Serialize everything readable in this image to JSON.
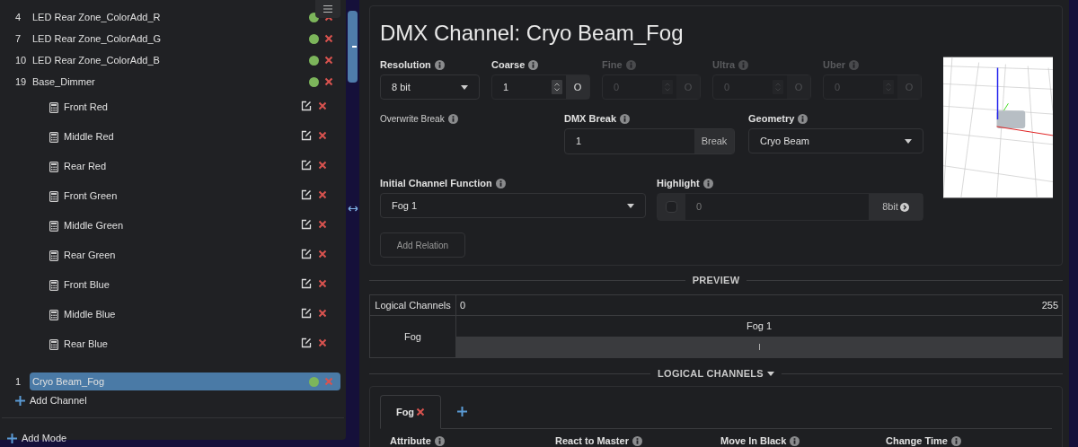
{
  "sidebar": {
    "channels": [
      {
        "number": "4",
        "name": "LED Rear Zone_ColorAdd_R",
        "selected": false
      },
      {
        "number": "7",
        "name": "LED Rear Zone_ColorAdd_G",
        "selected": false
      },
      {
        "number": "10",
        "name": "LED Rear Zone_ColorAdd_B",
        "selected": false
      },
      {
        "number": "19",
        "name": "Base_Dimmer",
        "selected": false,
        "children": [
          {
            "name": "Front Red"
          },
          {
            "name": "Middle Red"
          },
          {
            "name": "Rear Red"
          },
          {
            "name": "Front Green"
          },
          {
            "name": "Middle Green"
          },
          {
            "name": "Rear Green"
          },
          {
            "name": "Front Blue"
          },
          {
            "name": "Middle Blue"
          },
          {
            "name": "Rear Blue"
          }
        ]
      },
      {
        "number": "1",
        "name": "Cryo Beam_Fog",
        "selected": true
      }
    ],
    "add_channel": "Add Channel",
    "add_mode": "Add Mode"
  },
  "channel": {
    "title": "DMX Channel: Cryo Beam_Fog",
    "resolution": {
      "label": "Resolution",
      "value": "8 bit"
    },
    "offsets": [
      {
        "label": "Coarse",
        "value": "1",
        "button": "O",
        "disabled": false
      },
      {
        "label": "Fine",
        "value": "0",
        "button": "O",
        "disabled": true
      },
      {
        "label": "Ultra",
        "value": "0",
        "button": "O",
        "disabled": true
      },
      {
        "label": "Uber",
        "value": "0",
        "button": "O",
        "disabled": true
      }
    ],
    "overwrite_break": {
      "label": "Overwrite Break"
    },
    "dmx_break": {
      "label": "DMX Break",
      "value": "1",
      "button": "Break"
    },
    "geometry": {
      "label": "Geometry",
      "value": "Cryo Beam"
    },
    "initial_function": {
      "label": "Initial Channel Function",
      "value": "Fog 1"
    },
    "highlight": {
      "label": "Highlight",
      "checked": false,
      "value": "0",
      "button": "8bit"
    },
    "add_relation": "Add Relation"
  },
  "preview": {
    "heading": "PREVIEW",
    "header": {
      "label": "Logical Channels",
      "min": "0",
      "max": "255"
    },
    "rows": [
      {
        "label": "Fog",
        "functions": [
          {
            "name": "Fog 1"
          }
        ]
      }
    ]
  },
  "logical_channels": {
    "heading": "LOGICAL CHANNELS",
    "tabs": [
      {
        "label": "Fog",
        "selected": true
      }
    ],
    "columns": [
      "Attribute",
      "React to Master",
      "Move In Black",
      "Change Time"
    ]
  }
}
